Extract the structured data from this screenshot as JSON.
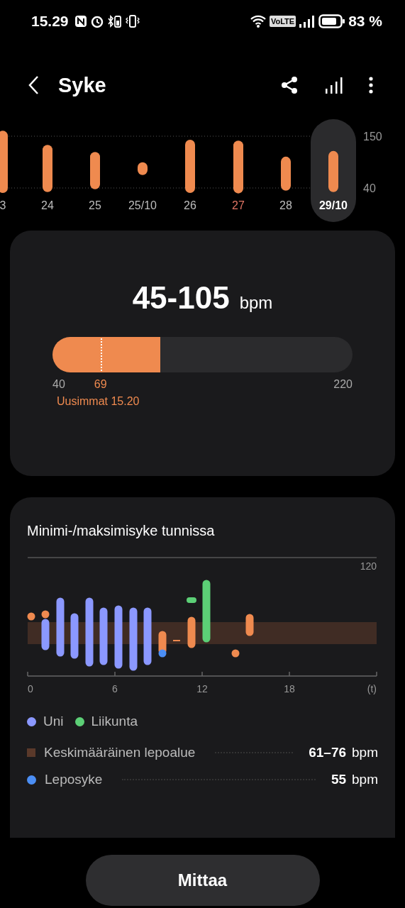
{
  "status_bar": {
    "time": "15.29",
    "network_badge": "VoLTE",
    "battery": "83 %"
  },
  "header": {
    "title": "Syke"
  },
  "daily_chart": {
    "y_labels": [
      "150",
      "40"
    ],
    "days": [
      {
        "label": "3",
        "selected": false,
        "kind": "weekday"
      },
      {
        "label": "24",
        "selected": false,
        "kind": "weekday"
      },
      {
        "label": "25",
        "selected": false,
        "kind": "weekday"
      },
      {
        "label": "25/10",
        "selected": false,
        "kind": "weekday"
      },
      {
        "label": "26",
        "selected": false,
        "kind": "weekday"
      },
      {
        "label": "27",
        "selected": false,
        "kind": "sunday"
      },
      {
        "label": "28",
        "selected": false,
        "kind": "weekday"
      },
      {
        "label": "29/10",
        "selected": true,
        "kind": "weekday"
      }
    ]
  },
  "summary": {
    "range": "45-105",
    "unit": "bpm",
    "gauge": {
      "level": 0.36,
      "min_label": "40",
      "max_label": "220"
    },
    "latest": {
      "level": 0.16,
      "value": "69",
      "label": "Uusimmat 15.20"
    }
  },
  "hourly": {
    "title": "Minimi-/maksimisyke tunnissa",
    "y_label": "120",
    "x_labels": [
      "0",
      "6",
      "12",
      "18",
      "(t)"
    ],
    "legend": [
      {
        "label": "Uni",
        "color": "#8b98ff"
      },
      {
        "label": "Liikunta",
        "color": "#5ccf76"
      }
    ],
    "stats": [
      {
        "kind": "square",
        "color": "#5a392a",
        "label": "Keskimääräinen lepoalue",
        "value": "61–76",
        "unit": "bpm"
      },
      {
        "kind": "dot",
        "color": "#4b8ef4",
        "label": "Leposyke",
        "value": "55",
        "unit": "bpm"
      }
    ]
  },
  "measure_button": "Mittaa"
}
